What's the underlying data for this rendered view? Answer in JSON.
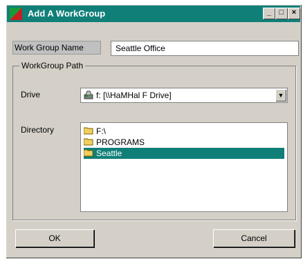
{
  "window": {
    "title": "Add A WorkGroup",
    "controls": {
      "minimize": "_",
      "maximize": "□",
      "close": "×"
    }
  },
  "workgroup_name": {
    "label": "Work Group Name",
    "value": "Seattle Office"
  },
  "workgroup_path": {
    "group_title": "WorkGroup Path",
    "drive_label": "Drive",
    "drive_value": "f: [\\\\HaMHal F Drive]",
    "directory_label": "Directory",
    "directories": [
      {
        "name": "F:\\",
        "selected": false
      },
      {
        "name": "PROGRAMS",
        "selected": false
      },
      {
        "name": "Seattle",
        "selected": true
      }
    ]
  },
  "buttons": {
    "ok": "OK",
    "cancel": "Cancel"
  },
  "colors": {
    "title_bar": "#0f7f78",
    "selection": "#0f7f78",
    "face": "#d4d0c8"
  },
  "icons": [
    "app-icon",
    "minimize-icon",
    "maximize-icon",
    "close-icon",
    "drive-icon",
    "folder-open-icon",
    "dropdown-arrow-icon"
  ]
}
